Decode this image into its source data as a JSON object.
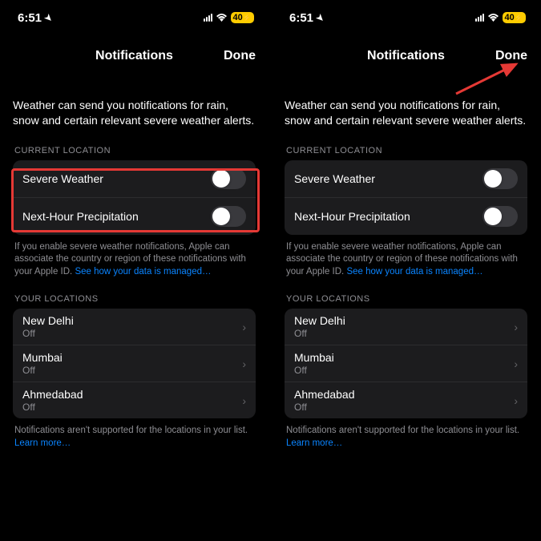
{
  "status": {
    "time": "6:51",
    "battery": "40"
  },
  "nav": {
    "title": "Notifications",
    "done": "Done"
  },
  "description": "Weather can send you notifications for rain, snow and certain relevant severe weather alerts.",
  "sections": {
    "current_location_header": "CURRENT LOCATION",
    "your_locations_header": "YOUR LOCATIONS"
  },
  "toggles": {
    "severe_weather": "Severe Weather",
    "next_hour": "Next-Hour Precipitation"
  },
  "footer_current": {
    "text": "If you enable severe weather notifications, Apple can associate the country or region of these notifications with your Apple ID. ",
    "link": "See how your data is managed…"
  },
  "locations": [
    {
      "name": "New Delhi",
      "status": "Off"
    },
    {
      "name": "Mumbai",
      "status": "Off"
    },
    {
      "name": "Ahmedabad",
      "status": "Off"
    }
  ],
  "footer_locations": {
    "text": "Notifications aren't supported for the locations in your list. ",
    "link": "Learn more…"
  },
  "annotations": {
    "highlight_color": "#e53935",
    "arrow_color": "#e53935"
  }
}
